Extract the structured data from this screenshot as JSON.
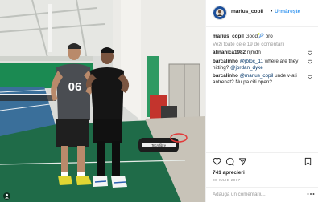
{
  "header": {
    "username": "marius_copil",
    "separator": "•",
    "follow_label": "Urmărește"
  },
  "caption": {
    "username": "marius_copil",
    "text": "Good🎾 bro"
  },
  "view_all_comments": "Vezi toate cele 19 de comentarii",
  "comments": [
    {
      "username": "alinanica1982",
      "text": "njmdn"
    },
    {
      "username": "barcalinho",
      "pre": "",
      "mention1": "@jbloc_11",
      "mid": " where are they hitting? ",
      "mention2": "@jordan_dyke",
      "text": ""
    },
    {
      "username": "barcalinho",
      "pre": "",
      "mention1": "@marius_copil",
      "mid": " unde v-ați antrenat? Nu pa citi open?",
      "mention2": "",
      "text": ""
    }
  ],
  "likes_text": "741 aprecieri",
  "date_text": "30 IULIE 2017",
  "comment_input": {
    "placeholder": "Adaugă un comentariu..."
  },
  "photo": {
    "shirt_text": "06",
    "bag_brand": "Tecnifibre"
  },
  "colors": {
    "link_blue": "#3897f0",
    "mention_blue": "#003569",
    "muted_gray": "#999999",
    "court_green": "#1f6b48",
    "wall_green": "#1b8a52",
    "court_blue": "#3a6f9a"
  },
  "icons": [
    "heart-icon",
    "comment-icon",
    "share-icon",
    "bookmark-icon",
    "more-dots-icon",
    "user-icon"
  ]
}
